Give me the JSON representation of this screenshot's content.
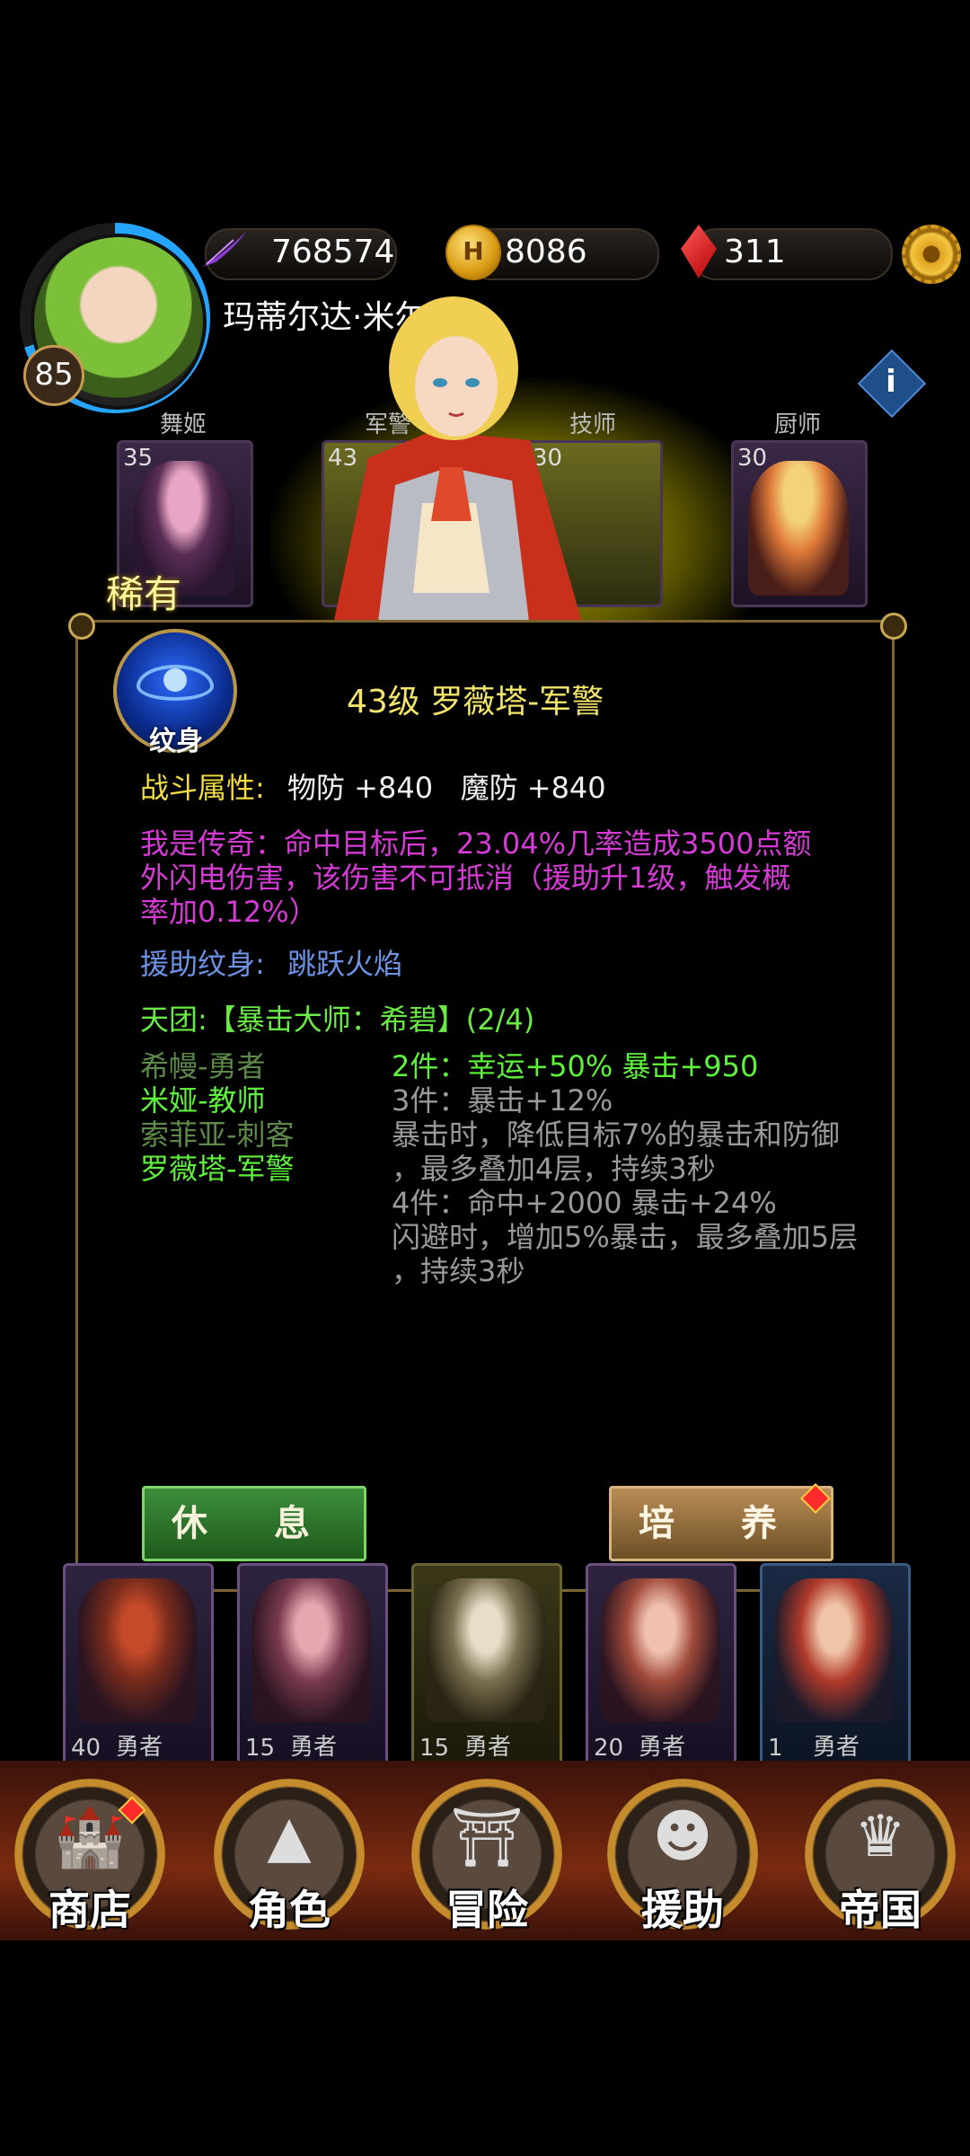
{
  "resources": {
    "power": "768574",
    "gold": "8086",
    "gems": "311",
    "gold_symbol": "H"
  },
  "player": {
    "level": "85",
    "name": "玛蒂尔达·米尔"
  },
  "roles": [
    {
      "label": "舞姬",
      "level": "35"
    },
    {
      "label": "军警",
      "level": "43"
    },
    {
      "label": "技师",
      "level": "30"
    },
    {
      "label": "厨师",
      "level": "30"
    }
  ],
  "rarity": "稀有",
  "detail": {
    "emblem_label": "纹身",
    "title": "43级 罗薇塔-军警",
    "combat_label": "战斗属性:",
    "combat_stats": "物防 +840   魔防 +840",
    "legend_text_1": "我是传奇：命中目标后，23.04%几率造成3500点额",
    "legend_text_2": "外闪电伤害，该伤害不可抵消（援助升1级，触发概",
    "legend_text_3": "率加0.12%）",
    "assist_label": "援助纹身:",
    "assist_value": "跳跃火焰",
    "team_line": "天团:【暴击大师：希碧】(2/4)",
    "members": [
      "希幔-勇者",
      "米娅-教师",
      "索菲亚-刺客",
      "罗薇塔-军警"
    ],
    "bonuses": [
      "2件：幸运+50% 暴击+950",
      "3件：暴击+12%",
      "暴击时，降低目标7%的暴击和防御",
      "，最多叠加4层，持续3秒",
      "4件：命中+2000 暴击+24%",
      "闪避时，增加5%暴击，最多叠加5层",
      "，持续3秒"
    ],
    "rest_button": "休 息",
    "train_button": "培 养"
  },
  "hero_cards": [
    {
      "level": "40",
      "type": "勇者"
    },
    {
      "level": "15",
      "type": "勇者"
    },
    {
      "level": "15",
      "type": "勇者"
    },
    {
      "level": "20",
      "type": "勇者"
    },
    {
      "level": "1",
      "type": "勇者"
    }
  ],
  "nav": [
    {
      "label": "商店",
      "icon": "castle-icon"
    },
    {
      "label": "角色",
      "icon": "hood-icon"
    },
    {
      "label": "冒险",
      "icon": "gate-icon"
    },
    {
      "label": "援助",
      "icon": "girl-icon"
    },
    {
      "label": "帝国",
      "icon": "crown-icon"
    }
  ],
  "colors": {
    "accent_yellow": "#f2dd44",
    "legend_magenta": "#d63bd6",
    "assist_blue": "#6d93e6",
    "set_green": "#6bea46"
  }
}
